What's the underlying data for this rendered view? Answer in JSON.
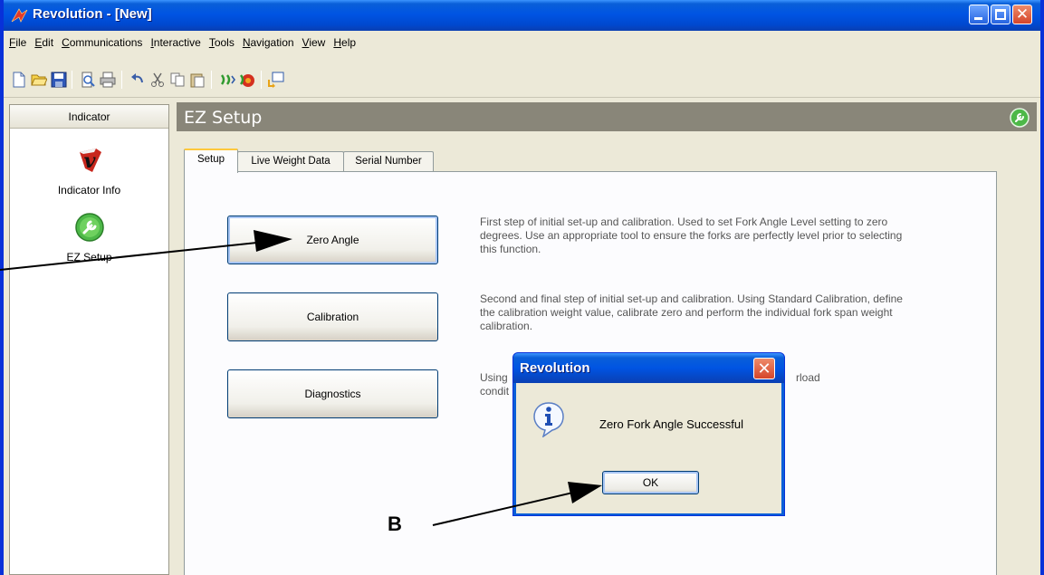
{
  "window": {
    "title": "Revolution - [New]",
    "title_bar_color": "#0054e3"
  },
  "menu": {
    "items": [
      {
        "label": "File",
        "underline": "F",
        "rest": "ile"
      },
      {
        "label": "Edit",
        "underline": "E",
        "rest": "dit"
      },
      {
        "label": "Communications",
        "underline": "C",
        "rest": "ommunications"
      },
      {
        "label": "Interactive",
        "underline": "I",
        "rest": "nteractive"
      },
      {
        "label": "Tools",
        "underline": "T",
        "rest": "ools"
      },
      {
        "label": "Navigation",
        "underline": "N",
        "rest": "avigation"
      },
      {
        "label": "View",
        "underline": "V",
        "rest": "iew"
      },
      {
        "label": "Help",
        "underline": "H",
        "rest": "elp"
      }
    ]
  },
  "toolbar": {
    "icons": [
      "new-file-icon",
      "open-folder-icon",
      "save-icon",
      "print-preview-icon",
      "print-icon",
      "undo-icon",
      "cut-icon",
      "copy-icon",
      "paste-icon",
      "connect-icon",
      "disconnect-icon",
      "transfer-icon"
    ]
  },
  "sidebar": {
    "header": "Indicator",
    "items": [
      {
        "label": "Indicator Info",
        "icon": "indicator-info-icon"
      },
      {
        "label": "EZ Setup",
        "icon": "wrench-icon"
      }
    ]
  },
  "main": {
    "title": "EZ Setup",
    "tabs": [
      {
        "label": "Setup",
        "active": true
      },
      {
        "label": "Live Weight Data",
        "active": false
      },
      {
        "label": "Serial Number",
        "active": false
      }
    ],
    "actions": [
      {
        "label": "Zero Angle",
        "description": "First step of initial set-up and calibration. Used to set Fork Angle Level setting to zero degrees. Use an appropriate tool to ensure the forks are perfectly level prior to selecting this function."
      },
      {
        "label": "Calibration",
        "description": "Second and final step of initial set-up and calibration. Using Standard Calibration, define the calibration weight value, calibrate zero and perform the individual fork span weight calibration."
      },
      {
        "label": "Diagnostics",
        "description_start": "Using",
        "description_end": "rload",
        "description_line2": "condit"
      }
    ]
  },
  "dialog": {
    "title": "Revolution",
    "message": "Zero Fork Angle Successful",
    "ok_label": "OK",
    "icon": "info-icon"
  },
  "annotations": {
    "label_b": "B"
  }
}
